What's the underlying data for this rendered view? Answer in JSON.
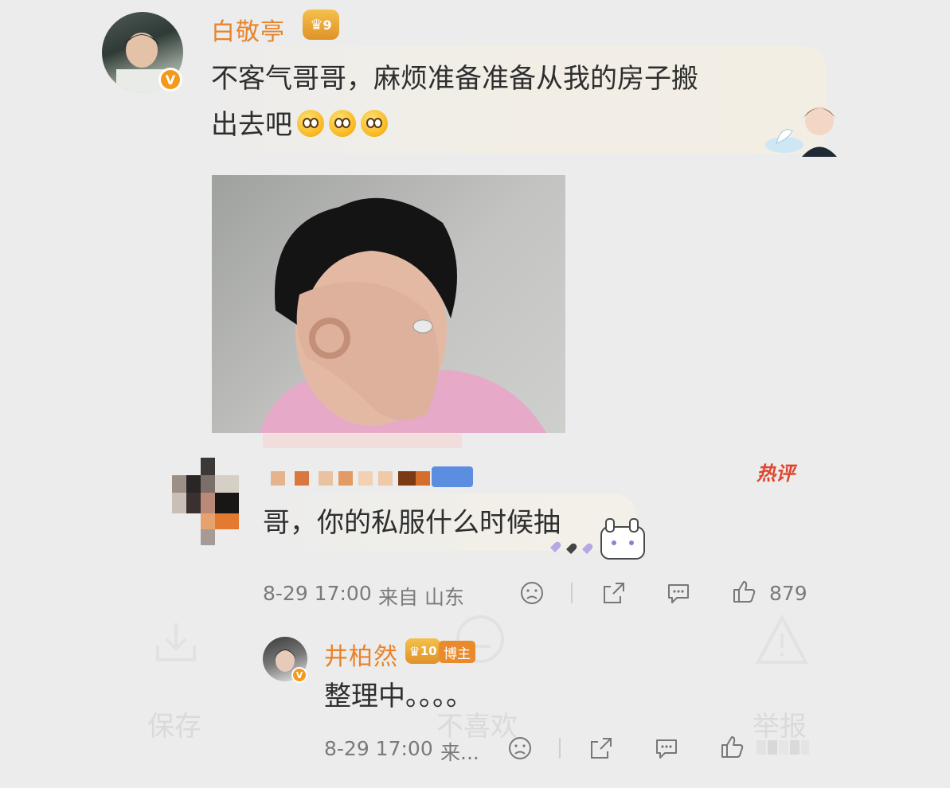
{
  "comments": [
    {
      "username": "白敬亭",
      "level": "9",
      "verified": "V",
      "text_line1": "不客气哥哥，麻烦准备准备从我的房子搬",
      "text_line2": "出去吧"
    },
    {
      "hot_label": "热评",
      "text": "哥，你的私服什么时候抽",
      "time": "8-29 17:00",
      "source": "来自 山东",
      "likes": "879"
    },
    {
      "username": "井柏然",
      "level": "10",
      "author_tag": "博主",
      "verified": "V",
      "text": "整理中。。。。",
      "time": "8-29 17:00",
      "source": "来..."
    }
  ],
  "background_menu": {
    "save": "保存",
    "dislike": "不喜欢",
    "report": "举报"
  },
  "colors": {
    "background": "#ececec",
    "username": "#e8832b",
    "badge": "#f39a1d",
    "hot": "#e0452e"
  }
}
